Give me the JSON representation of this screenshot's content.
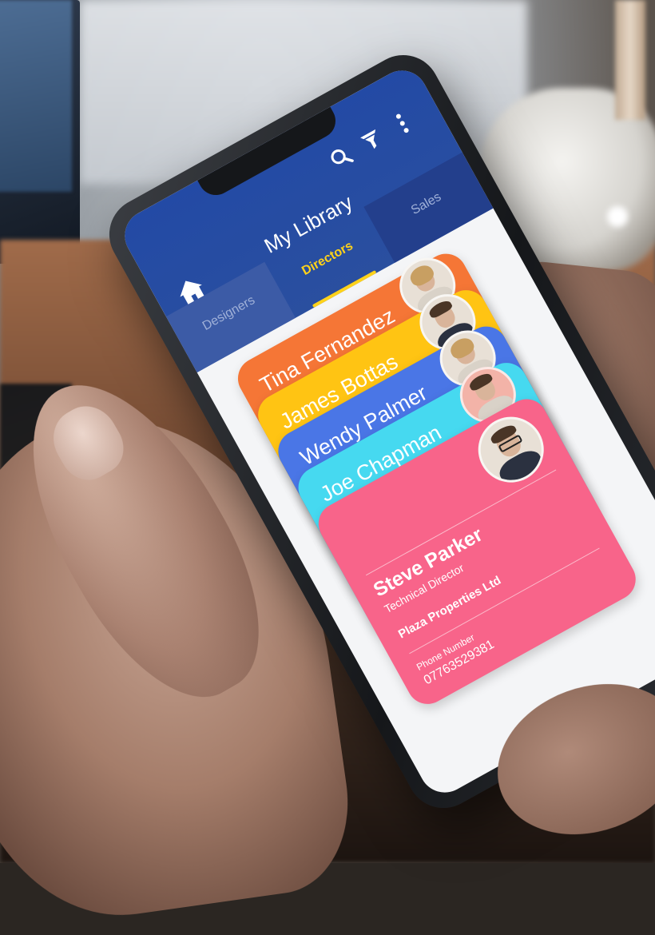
{
  "app": {
    "title": "My Library"
  },
  "tabs": [
    {
      "label": "Designers",
      "active": false
    },
    {
      "label": "Directors",
      "active": true
    },
    {
      "label": "Sales",
      "active": false
    }
  ],
  "icons": {
    "home": "home-icon",
    "search": "search-icon",
    "filter": "filter-icon",
    "more": "more-vertical-icon"
  },
  "colors": {
    "header": "#234aa5",
    "active_tab": "#ffd21a",
    "card_colors": [
      "#f57636",
      "#ffc413",
      "#4a76e6",
      "#46d9f0",
      "#f8648a"
    ]
  },
  "contacts": [
    {
      "name": "Tina Fernandez"
    },
    {
      "name": "James Bottas"
    },
    {
      "name": "Wendy Palmer"
    },
    {
      "name": "Joe Chapman"
    }
  ],
  "selected_card": {
    "name": "Steve Parker",
    "title": "Technical Director",
    "company": "Plaza Properties Ltd",
    "phone_label": "Phone Number",
    "phone": "07763529381"
  }
}
